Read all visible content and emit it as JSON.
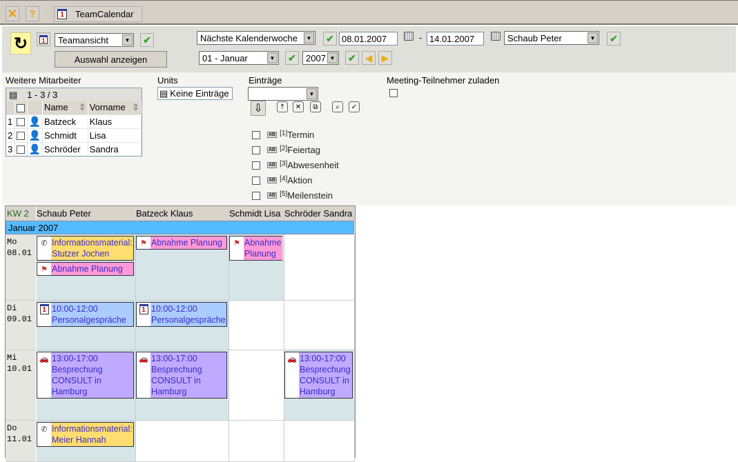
{
  "topbar": {
    "close_icon": "close-icon",
    "help_icon": "help-icon",
    "tab_label": "TeamCalendar",
    "tab_icon": "calendar-1"
  },
  "toolbar": {
    "view_select": "Teamansicht",
    "show_button": "Auswahl anzeigen",
    "range_select": "Nächste Kalenderwoche",
    "date_from": "08.01.2007",
    "date_sep": "-",
    "date_to": "14.01.2007",
    "person_select": "Schaub Peter",
    "month_select": "01 - Januar",
    "year_select": "2007"
  },
  "employees": {
    "title": "Weitere Mitarbeiter",
    "pager": "1 - 3 / 3",
    "headers": {
      "name": "Name",
      "firstname": "Vorname"
    },
    "rows": [
      {
        "n": "1",
        "name": "Batzeck",
        "firstname": "Klaus"
      },
      {
        "n": "2",
        "name": "Schmidt",
        "firstname": "Lisa"
      },
      {
        "n": "3",
        "name": "Schröder",
        "firstname": "Sandra"
      }
    ]
  },
  "units": {
    "title": "Units",
    "value": "Keine Einträge"
  },
  "entries": {
    "title": "Einträge",
    "select": "",
    "types": [
      {
        "n": "[1]",
        "label": "Termin"
      },
      {
        "n": "[2]",
        "label": "Feiertag"
      },
      {
        "n": "[3]",
        "label": "Abwesenheit"
      },
      {
        "n": "[4]",
        "label": "Aktion"
      },
      {
        "n": "[5]",
        "label": "Meilenstein"
      }
    ]
  },
  "meeting": {
    "label": "Meeting-Teilnehmer zuladen"
  },
  "calendar": {
    "week": "KW 2",
    "columns": [
      "Schaub Peter",
      "Batzeck Klaus",
      "Schmidt Lisa",
      "Schröder Sandra"
    ],
    "month": "Januar 2007",
    "days": [
      {
        "name": "Mo",
        "date": "08.01"
      },
      {
        "name": "Di",
        "date": "09.01"
      },
      {
        "name": "Mi",
        "date": "10.01"
      },
      {
        "name": "Do",
        "date": "11.01"
      }
    ],
    "colors": {
      "call": "#ffdd70",
      "milestone": "#ff99d8",
      "appointment": "#aaccff",
      "trip": "#c0aaff"
    },
    "events": [
      {
        "day": 0,
        "col": 0,
        "type": "call",
        "lines": [
          "Informationsmaterial:",
          "Stutzer Jochen"
        ]
      },
      {
        "day": 0,
        "col": 0,
        "type": "milestone",
        "lines": [
          "Abnahme Planung"
        ]
      },
      {
        "day": 0,
        "col": 1,
        "type": "milestone",
        "lines": [
          "Abnahme Planung"
        ]
      },
      {
        "day": 0,
        "col": 2,
        "type": "milestone",
        "lines": [
          "Abnahme",
          "Planung"
        ]
      },
      {
        "day": 1,
        "col": 0,
        "type": "appointment",
        "lines": [
          "10:00-12:00",
          "Personalgespräche"
        ]
      },
      {
        "day": 1,
        "col": 1,
        "type": "appointment",
        "lines": [
          "10:00-12:00",
          "Personalgespräche"
        ]
      },
      {
        "day": 2,
        "col": 0,
        "type": "trip",
        "lines": [
          "13:00-17:00",
          "Besprechung",
          "CONSULT in",
          "Hamburg"
        ]
      },
      {
        "day": 2,
        "col": 1,
        "type": "trip",
        "lines": [
          "13:00-17:00",
          "Besprechung",
          "CONSULT in",
          "Hamburg"
        ]
      },
      {
        "day": 2,
        "col": 3,
        "type": "trip",
        "lines": [
          "13:00-17:00",
          "Besprechung",
          "CONSULT in",
          "Hamburg"
        ]
      },
      {
        "day": 3,
        "col": 0,
        "type": "call",
        "lines": [
          "Informationsmaterial:",
          "Meier Hannah"
        ]
      }
    ]
  }
}
